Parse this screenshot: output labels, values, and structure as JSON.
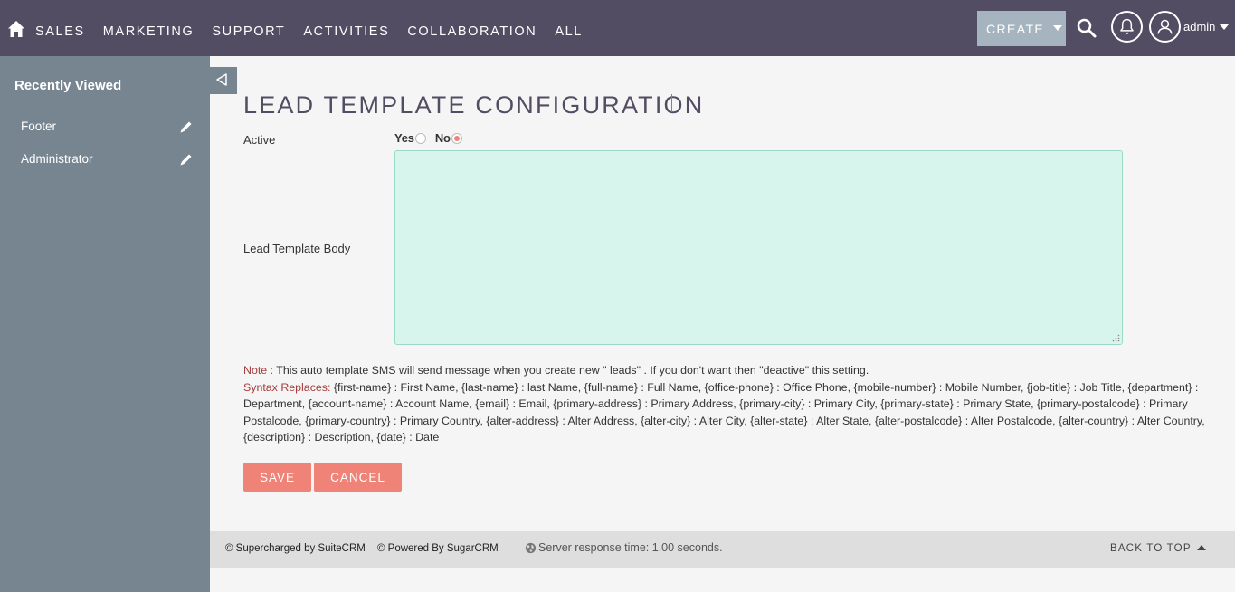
{
  "nav": {
    "items": [
      "SALES",
      "MARKETING",
      "SUPPORT",
      "ACTIVITIES",
      "COLLABORATION",
      "ALL"
    ],
    "create_label": "CREATE",
    "user_label": "admin"
  },
  "sidebar": {
    "title": "Recently Viewed",
    "items": [
      {
        "label": "Footer"
      },
      {
        "label": "Administrator"
      }
    ]
  },
  "main": {
    "title": "LEAD TEMPLATE CONFIGURATION",
    "active_label": "Active",
    "radio_yes": "Yes",
    "radio_no": "No",
    "active_value": "No",
    "body_label": "Lead Template Body",
    "body_value": "",
    "note_label": "Note :",
    "note_text": " This auto template SMS will send message when you create new \" leads\" . If you don't want then \"deactive\" this setting.",
    "syntax_label": "Syntax Replaces:",
    "syntax_text": " {first-name} : First Name, {last-name} : last Name, {full-name} : Full Name, {office-phone} : Office Phone, {mobile-number} : Mobile Number, {job-title} : Job Title, {department} : Department, {account-name} : Account Name, {email} : Email, {primary-address} : Primary Address, {primary-city} : Primary City, {primary-state} : Primary State, {primary-postalcode} : Primary Postalcode, {primary-country} : Primary Country, {alter-address} : Alter Address, {alter-city} : Alter City, {alter-state} : Alter State, {alter-postalcode} : Alter Postalcode, {alter-country} : Alter Country, {description} : Description, {date} : Date",
    "save_label": "SAVE",
    "cancel_label": "CANCEL"
  },
  "footer": {
    "suitecrm": "© Supercharged by SuiteCRM",
    "sugarcrm": "© Powered By SugarCRM",
    "server_time": "Server response time: 1.00 seconds.",
    "back_to_top": "BACK TO TOP"
  },
  "colors": {
    "nav_bg": "#534d64",
    "sidebar_bg": "#778591",
    "accent": "#f08377",
    "textarea_bg": "#d8f5ed"
  }
}
